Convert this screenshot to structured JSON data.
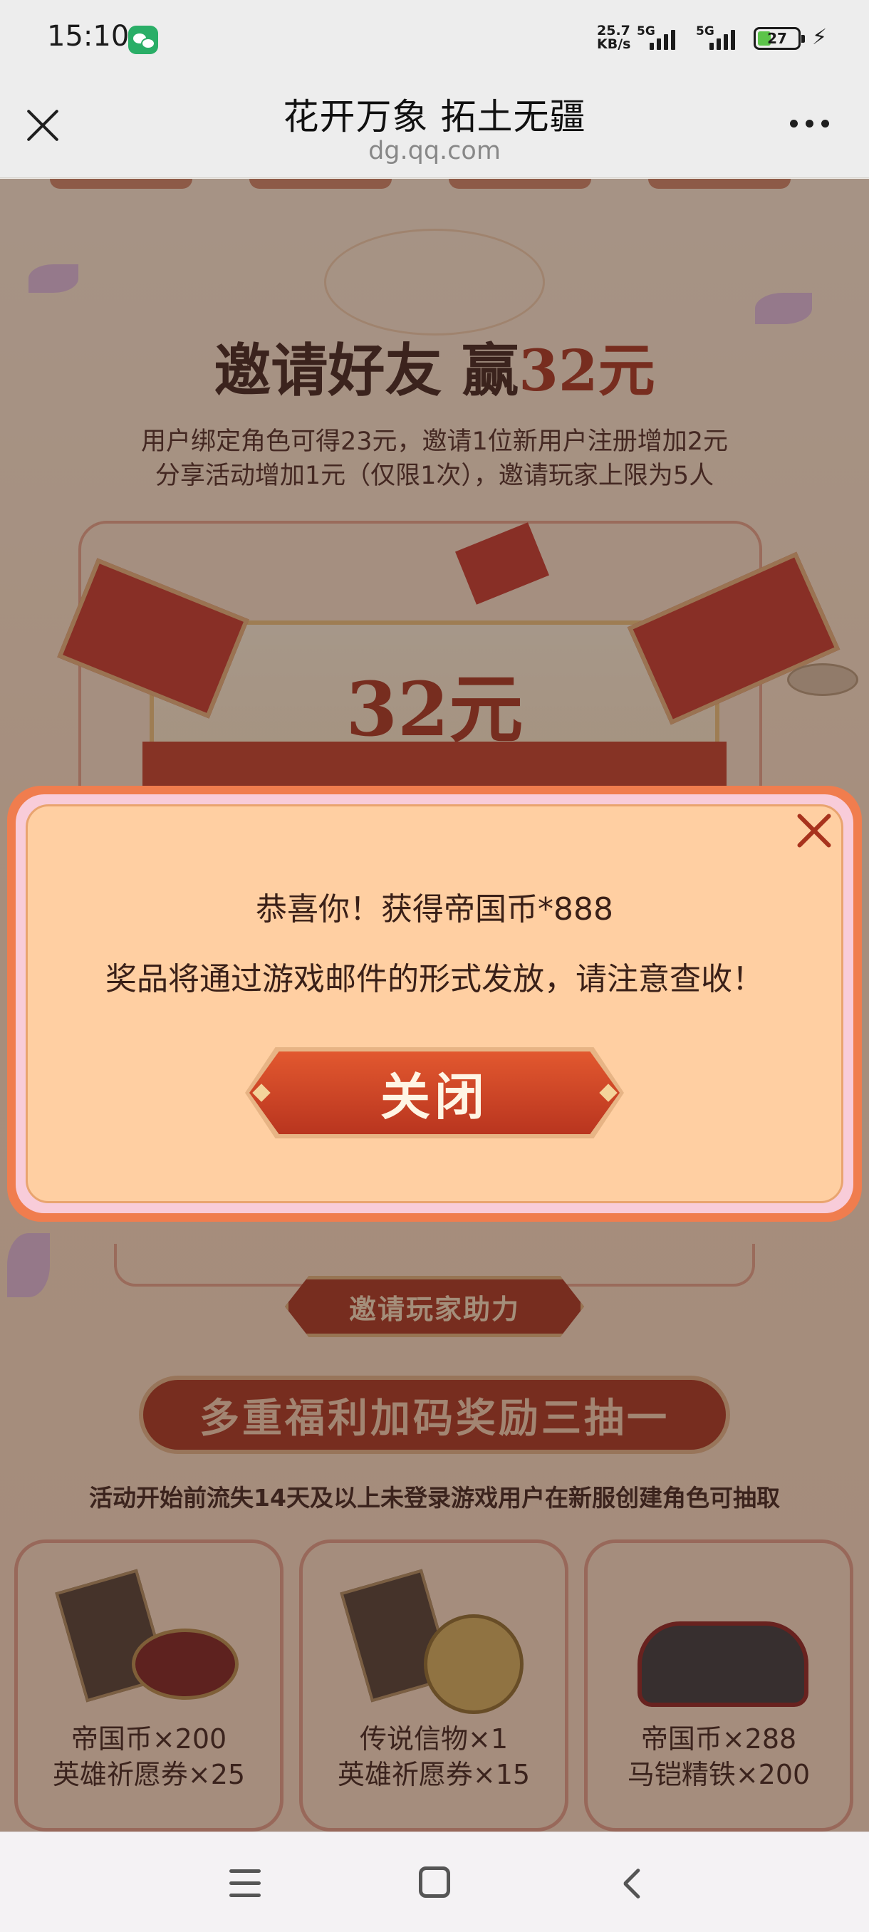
{
  "status_bar": {
    "time": "15:10",
    "app_icon": "wechat-icon",
    "net_speed_value": "25.7",
    "net_speed_unit": "KB/s",
    "sim1_label": "5G",
    "sim2_label": "5G",
    "battery_level": "27",
    "charging_icon": "bolt-icon"
  },
  "browser": {
    "title": "花开万象 拓土无疆",
    "url": "dg.qq.com",
    "close_icon": "close-icon",
    "more_icon": "more-dots-icon"
  },
  "page": {
    "title_prefix": "邀请好友 赢",
    "title_amount": "32元",
    "desc_line1": "用户绑定角色可得23元，邀请1位新用户注册增加2元",
    "desc_line2": "分享活动增加1元（仅限1次），邀请玩家上限为5人",
    "envelope_amount": "32元",
    "invite_button": "邀请玩家助力",
    "banner": "多重福利加码奖励三抽一",
    "rule_text": "活动开始前流失14天及以上未登录游戏用户在新服创建角色可抽取",
    "rewards": [
      {
        "line1": "帝国币×200",
        "line2": "英雄祈愿券×25"
      },
      {
        "line1": "传说信物×1",
        "line2": "英雄祈愿券×15"
      },
      {
        "line1": "帝国币×288",
        "line2": "马铠精铁×200"
      }
    ]
  },
  "modal": {
    "line1": "恭喜你！获得帝国币*888",
    "line2": "奖品将通过游戏邮件的形式发放，请注意查收！",
    "close_button": "关闭",
    "close_icon": "close-icon",
    "accent_color": "#a8331d"
  },
  "nav_bar": {
    "menu_icon": "menu-icon",
    "home_icon": "home-icon",
    "back_icon": "back-icon"
  }
}
